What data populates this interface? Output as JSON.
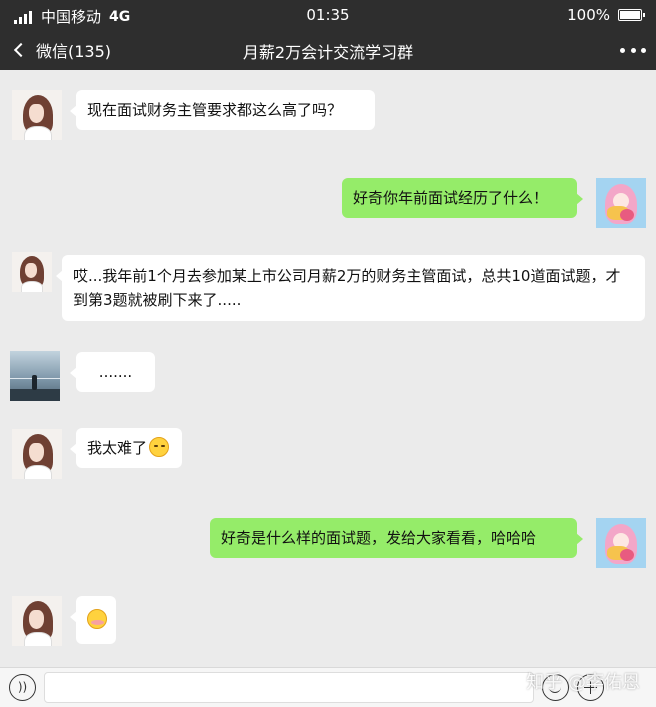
{
  "status_bar": {
    "carrier": "中国移动",
    "network": "4G",
    "time": "01:35",
    "battery": "100%",
    "battery_level": 1.0
  },
  "nav": {
    "back_label": "微信(135)",
    "title": "月薪2万会计交流学习群",
    "back_icon": "chevron-left-icon",
    "more_icon": "more-dots-icon"
  },
  "messages": [
    {
      "side": "in",
      "text": "现在面试财务主管要求都这么高了吗？"
    },
    {
      "side": "out",
      "text": "好奇你年前面试经历了什么！"
    },
    {
      "side": "in",
      "text": "哎...我年前1个月去参加某上市公司月薪2万的财务主管面试，总共10道面试题，才到第3题就被刷下来了....."
    },
    {
      "side": "in",
      "text": "......."
    },
    {
      "side": "in",
      "text": "我太难了",
      "emoji": "smiling-face-emoji"
    },
    {
      "side": "out",
      "text": "好奇是什么样的面试题，发给大家看看，哈哈哈"
    },
    {
      "side": "in",
      "text": "",
      "emoji": "flushed-face-emoji"
    }
  ],
  "input_bar": {
    "voice_icon": "voice-icon",
    "emoji_icon": "emoji-icon",
    "plus_icon": "plus-icon"
  },
  "watermark": "知乎 @李佑恩",
  "colors": {
    "header_bg": "#2e2e2e",
    "chat_bg": "#ebebeb",
    "out_bubble": "#95ec69",
    "in_bubble": "#ffffff"
  }
}
